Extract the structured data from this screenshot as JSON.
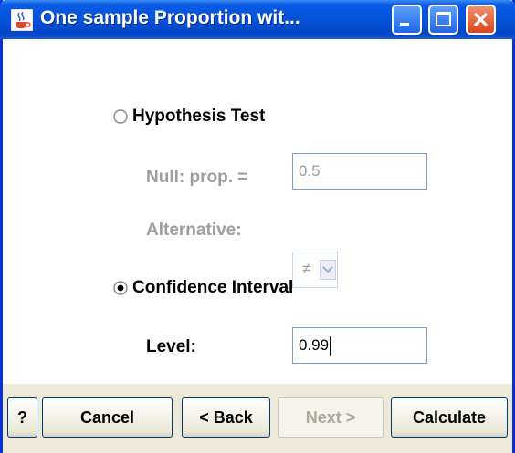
{
  "window": {
    "title": "One sample Proportion wit...",
    "icon": "java-cup-icon",
    "controls": [
      "minimize-icon",
      "maximize-icon",
      "close-icon"
    ]
  },
  "hypothesis": {
    "label": "Hypothesis Test",
    "selected": false,
    "null_label": "Null: prop. =",
    "null_value": "0.5",
    "alternative_label": "Alternative:",
    "alternative_value": "≠"
  },
  "confidence": {
    "label": "Confidence Interval",
    "selected": true,
    "level_label": "Level:",
    "level_value": "0.99"
  },
  "buttons": {
    "help": "?",
    "cancel": "Cancel",
    "back": "< Back",
    "next": "Next >",
    "calculate": "Calculate"
  },
  "colors": {
    "titlebar": "#0453d8",
    "dialog_bg": "#ece9d8",
    "disabled_text": "#9d9d9d"
  }
}
